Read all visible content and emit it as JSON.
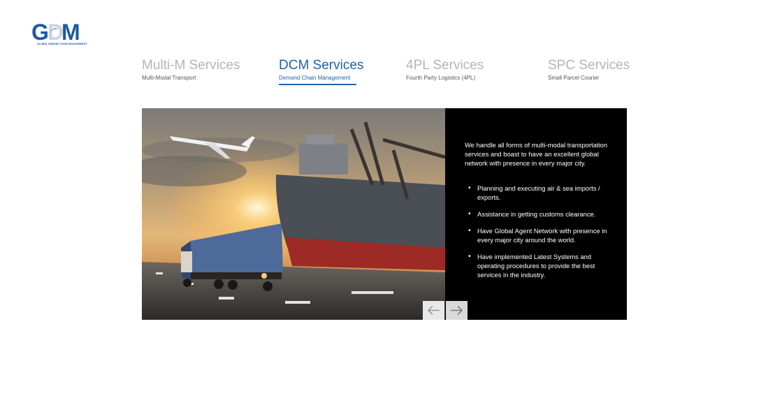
{
  "logo": {
    "text": "GDM",
    "tagline": "GLOBAL DEMAND CHAIN MANAGEMENT"
  },
  "tabs": [
    {
      "title": "Multi-M Services",
      "subtitle": "Multi-Modal Transport"
    },
    {
      "title": "DCM Services",
      "subtitle": "Demand Chain Management"
    },
    {
      "title": "4PL Services",
      "subtitle": "Fourth Party Logistics (4PL)"
    },
    {
      "title": "SPC Services",
      "subtitle": "Small Parcel Courier"
    }
  ],
  "active_tab": "DCM Services",
  "content": {
    "intro": "We handle all forms of multi-modal transportation services and boast to have an excellent global network with presence in every major city.",
    "bullets": [
      "Planning and executing air & sea imports / exports.",
      "Assistance in getting customs clearance.",
      "Have Global Agent Network with presence in every major city around the world.",
      "Have implemented Latest Systems and operating procedures to provide the best services in the industry."
    ]
  },
  "colors": {
    "accent": "#1f63a6",
    "inactive": "#b4b4b4",
    "panel_bg": "#000000"
  }
}
